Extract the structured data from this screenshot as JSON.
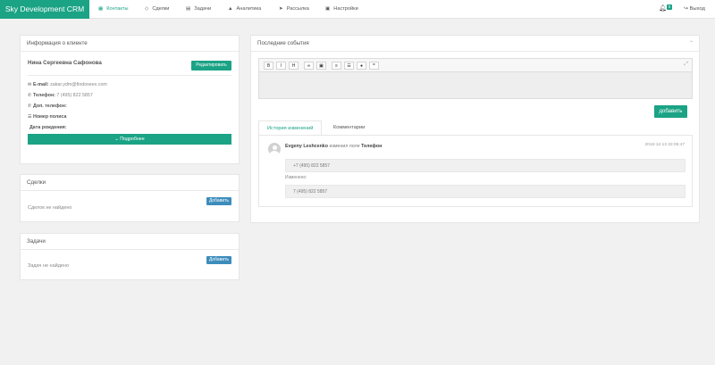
{
  "app": {
    "title": "Sky Development CRM"
  },
  "nav": {
    "items": [
      {
        "label": "Контакты",
        "icon": "grid-icon",
        "glyph": "▦"
      },
      {
        "label": "Сделки",
        "icon": "diamond-icon",
        "glyph": "◇"
      },
      {
        "label": "Задачи",
        "icon": "list-icon",
        "glyph": "▤"
      },
      {
        "label": "Аналитика",
        "icon": "chart-icon",
        "glyph": "▲"
      },
      {
        "label": "Рассылка",
        "icon": "paper-plane-icon",
        "glyph": "➤"
      },
      {
        "label": "Настройки",
        "icon": "settings-icon",
        "glyph": "▣"
      }
    ],
    "notification_count": "0",
    "logout_label": "Выход"
  },
  "client": {
    "panel_title": "Информация о клиенте",
    "name": "Нина Сергеевна Сафонова",
    "edit_label": "Редактировать",
    "email_label": "E-mail:",
    "email_value": "zakar.ydm@findoseex.com",
    "phone_label": "Телефон:",
    "phone_value": "7 (495) 822 5857",
    "alt_phone_label": "Доп. телефон:",
    "policy_label": "Номер полиса",
    "birth_label": "Дата рождения:",
    "details_label": "Подробнее"
  },
  "deals": {
    "panel_title": "Сделки",
    "add_label": "Добавить",
    "empty_text": "Сделок не найдено"
  },
  "tasks": {
    "panel_title": "Задачи",
    "add_label": "Добавить",
    "empty_text": "Задач не найдено"
  },
  "events": {
    "panel_title": "Последние события",
    "toolbar": [
      "B",
      "I",
      "H",
      "∞",
      "▣",
      "≡",
      "☰",
      "●",
      "❞"
    ],
    "add_label": "добавить",
    "tabs": [
      "История изменений",
      "Комментарии"
    ],
    "item": {
      "user": "Evgeny Leshcenko",
      "action": "изменил поле",
      "field": "Телефон",
      "time": "2016-12-13 22:05:47",
      "old_value": "+7 (495) 822 5857",
      "changed_label": "Изменено:",
      "new_value": "7 (495) 822 5857"
    }
  },
  "colors": {
    "accent": "#1aa385",
    "blue": "#3c8dbc",
    "background": "#f1f1f1"
  }
}
